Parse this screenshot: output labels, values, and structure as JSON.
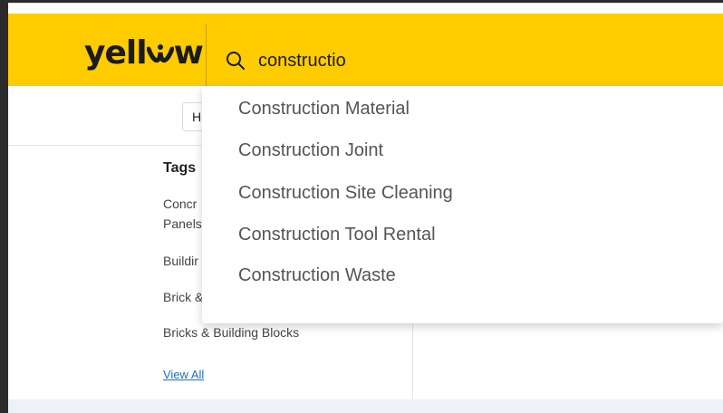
{
  "header": {
    "logo_text": "yell",
    "logo_text_end": "w",
    "search": {
      "value": "constructio"
    }
  },
  "subnav": {
    "button_label": "H"
  },
  "sidebar": {
    "tags_title": "Tags",
    "tags": [
      "Concr",
      "Panels",
      "Buildir",
      "Brick &",
      "Bricks & Building Blocks"
    ],
    "view_all": "View All"
  },
  "suggestions": [
    "Construction Material",
    "Construction Joint",
    "Construction Site Cleaning",
    "Construction Tool Rental",
    "Construction Waste"
  ],
  "colors": {
    "brand_yellow": "#ffcc00",
    "link_blue": "#1a6fc2"
  }
}
